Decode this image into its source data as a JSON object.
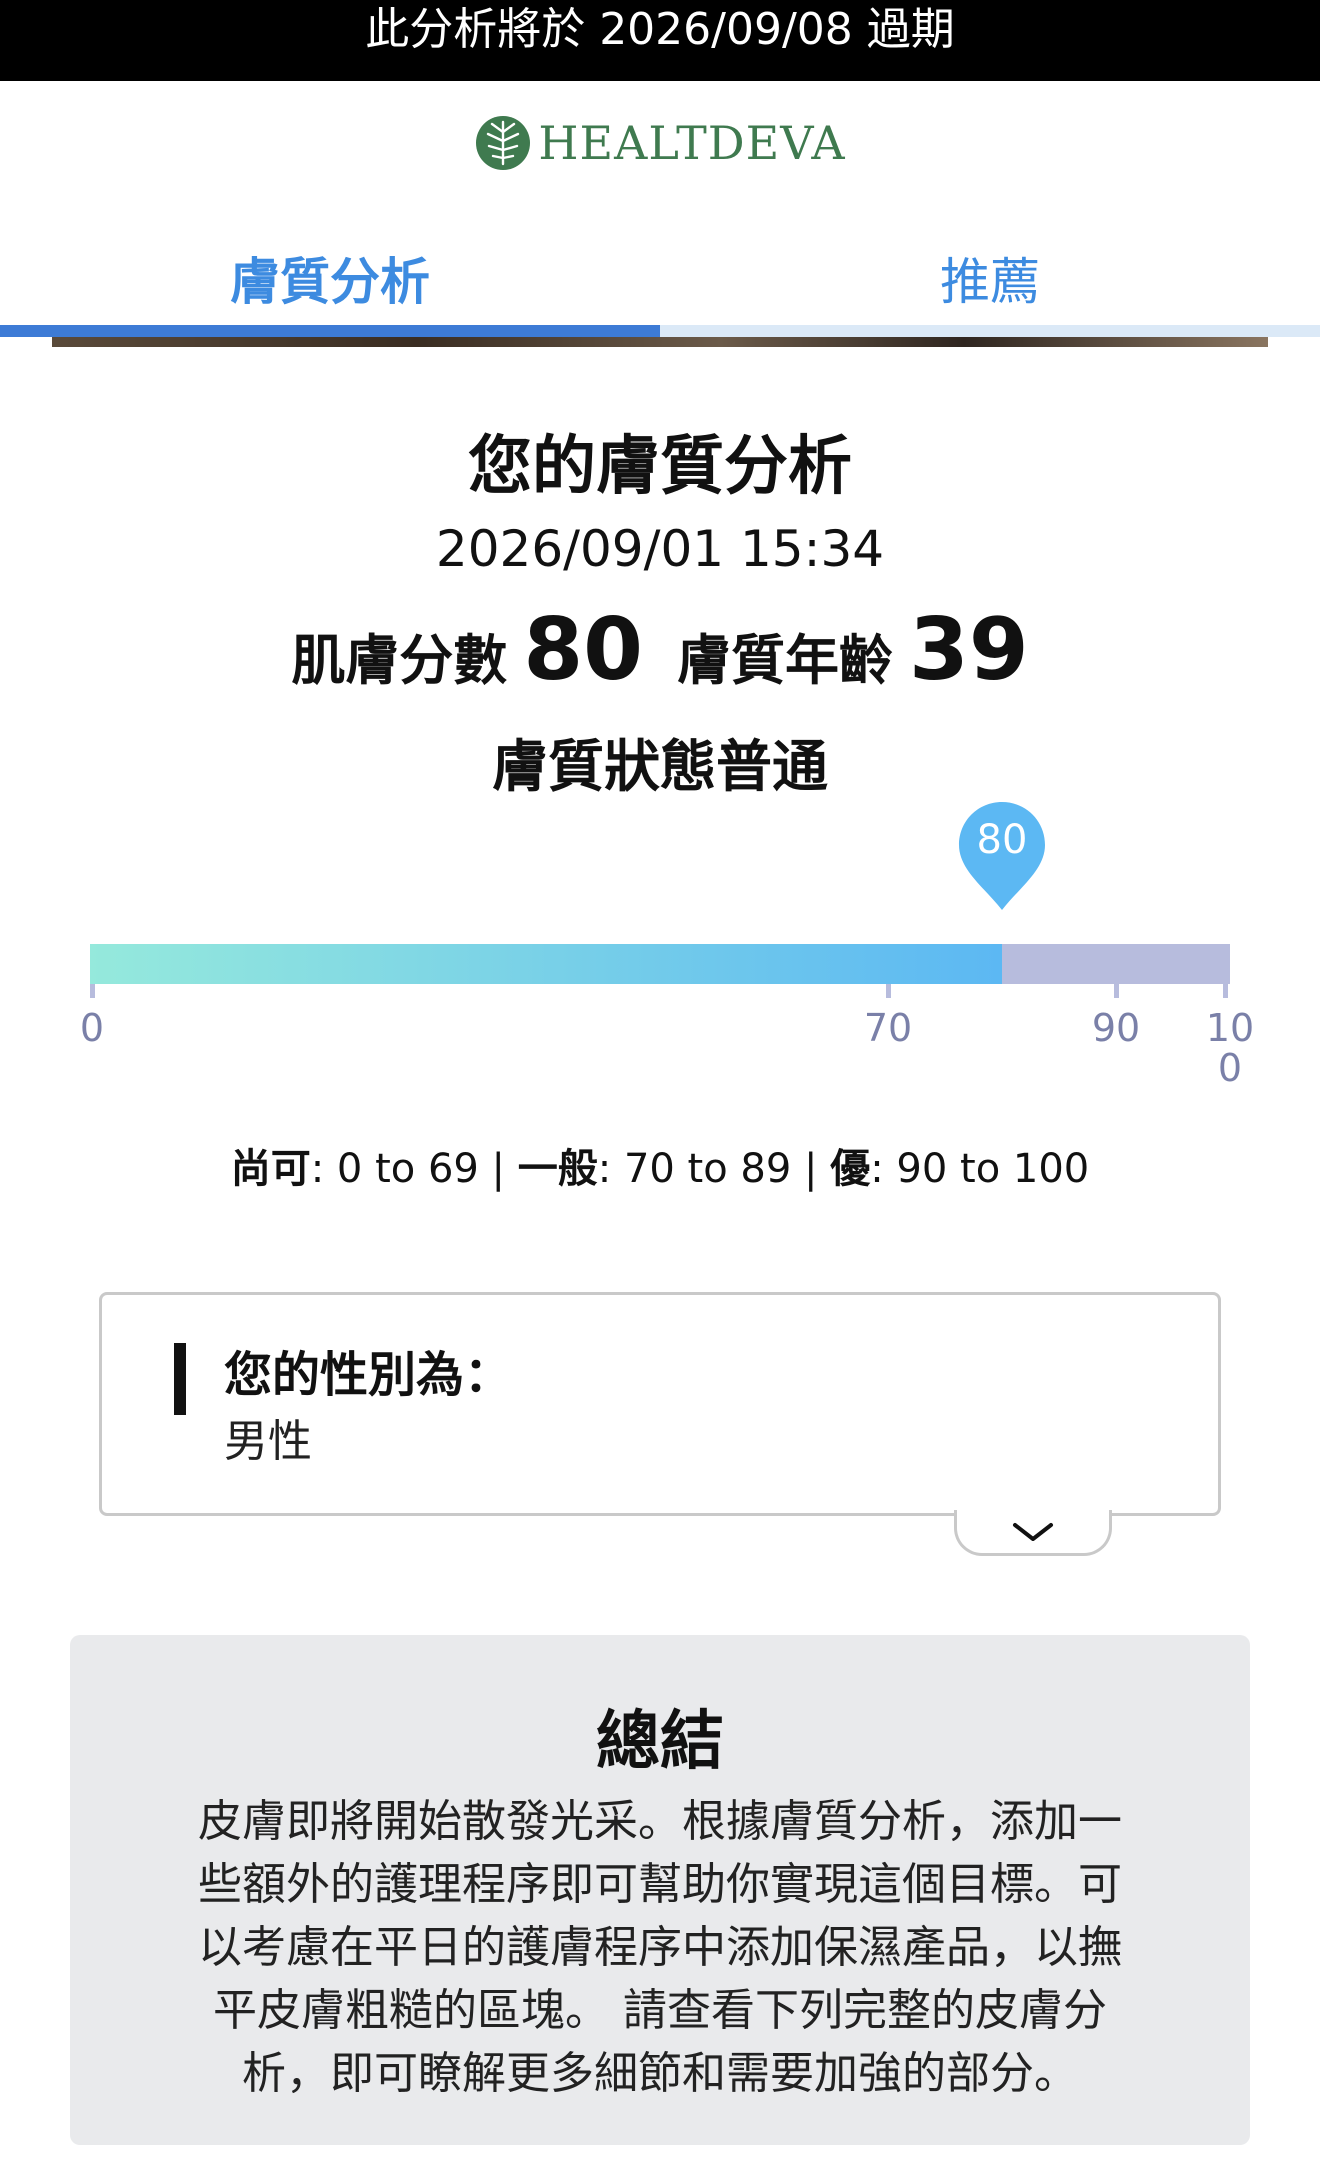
{
  "expiry": {
    "text": "此分析將於 2026/09/08 過期"
  },
  "brand": {
    "name": "HEALTDEVA",
    "color": "#3f7a4f",
    "logo_icon": "leaf-seal-icon"
  },
  "tabs": [
    {
      "label": "膚質分析",
      "active": true
    },
    {
      "label": "推薦",
      "active": false
    }
  ],
  "analysis": {
    "title": "您的膚質分析",
    "datetime": "2026/09/01 15:34",
    "skin_score_label": "肌膚分數",
    "skin_score": "80",
    "skin_age_label": "膚質年齡",
    "skin_age": "39",
    "status": "膚質狀態普通"
  },
  "gauge": {
    "value": 80,
    "min": 0,
    "max": 100,
    "pin_label": "80",
    "ticks": [
      {
        "value": 0,
        "label": "0"
      },
      {
        "value": 70,
        "label": "70"
      },
      {
        "value": 90,
        "label": "90"
      },
      {
        "value": 100,
        "label": "100"
      }
    ],
    "colors": {
      "fill_start": "#95e9dc",
      "fill_end": "#5cb8f3",
      "track": "#b7bcdd",
      "pin": "#5cb8f3"
    }
  },
  "ranges": {
    "fair_label": "尚可",
    "fair_range": ": 0 to 69 | ",
    "normal_label": "一般",
    "normal_range": ": 70 to 89 | ",
    "good_label": "優",
    "good_range": ": 90 to 100"
  },
  "gender": {
    "question": "您的性別為：",
    "answer": "男性",
    "expand_icon": "chevron-down-icon"
  },
  "summary": {
    "title": "總結",
    "lines": [
      "皮膚即將開始散發光采。根據膚質分析，添加一",
      "些額外的護理程序即可幫助你實現這個目標。可",
      "以考慮在平日的護膚程序中添加保濕產品，以撫",
      "平皮膚粗糙的區塊。 請查看下列完整的皮膚分",
      "析，即可瞭解更多細節和需要加強的部分。"
    ]
  }
}
